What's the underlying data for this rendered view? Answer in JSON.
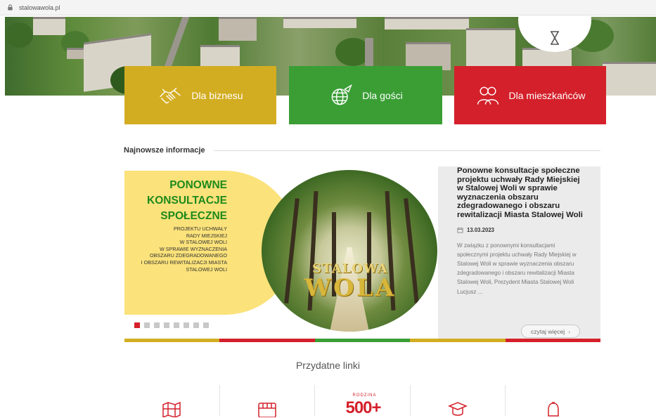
{
  "browser": {
    "url": "stalowawola.pl"
  },
  "tiles": [
    {
      "label": "Dla biznesu",
      "icon": "handshake-icon",
      "color": "#d3ad21"
    },
    {
      "label": "Dla gości",
      "icon": "globe-plane-icon",
      "color": "#3a9e35"
    },
    {
      "label": "Dla mieszkańców",
      "icon": "people-icon",
      "color": "#d4202a"
    }
  ],
  "news": {
    "section_title": "Najnowsze informacje",
    "promo": {
      "line1": "PONOWNE",
      "line2": "KONSULTACJE",
      "line3": "SPOŁECZNE",
      "small": [
        "PROJEKTU UCHWAŁY",
        "RADY MIEJSKIEJ",
        "W STALOWEJ WOLI",
        "W SPRAWIE WYZNACZENIA",
        "OBSZARU ZDEGRADOWANEGO",
        "I OBSZARU REWITALIZACJI MIASTA",
        "STALOWEJ WOLI"
      ],
      "wordmark_top": "STALOWA",
      "wordmark_bottom": "WOLA"
    },
    "title": "Ponowne konsultacje społeczne projektu uchwały Rady Miejskiej w Stalowej Woli w sprawie wyznaczenia obszaru zdegradowanego i obszaru rewitalizacji Miasta Stalowej Woli",
    "date": "13.03.2023",
    "lead": "W związku z ponownymi konsultacjami społecznymi projektu uchwały Rady Miejskiej w Stalowej Woli w sprawie wyznaczenia obszaru zdegradowanego i obszaru rewitalizacji Miasta Stalowej Woli, Prezydent Miasta Stalowej Woli Lucjusz ...",
    "read_more": "czytaj więcej",
    "slide_count": 8,
    "active_slide": 1
  },
  "colorbar": [
    "#d3ad21",
    "#d4202a",
    "#3a9e35",
    "#d3ad21",
    "#d4202a"
  ],
  "useful_links": {
    "title": "Przydatne linki",
    "items": [
      {
        "icon": "city-map-icon"
      },
      {
        "icon": "bus-icon"
      },
      {
        "icon": "rodzina-500-plus-logo",
        "top_text": "RODZINA",
        "num_text": "500+"
      },
      {
        "icon": "graduation-cap-icon"
      },
      {
        "icon": "alarm-bell-icon"
      }
    ]
  }
}
